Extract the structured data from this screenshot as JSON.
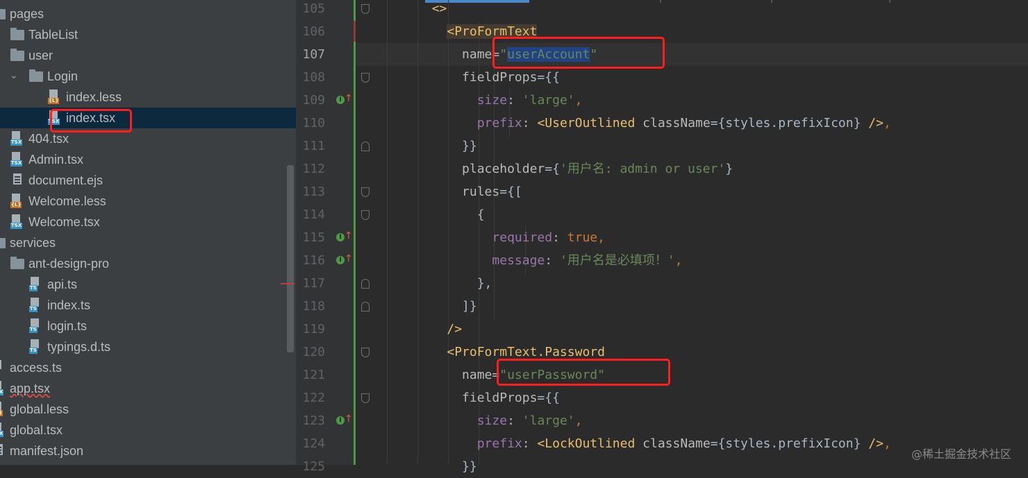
{
  "tree": {
    "items": [
      {
        "label": "pages",
        "indent": 0,
        "icon": "folder",
        "expanded": true
      },
      {
        "label": "TableList",
        "indent": 1,
        "icon": "folder"
      },
      {
        "label": "user",
        "indent": 1,
        "icon": "folder"
      },
      {
        "label": "Login",
        "indent": 2,
        "icon": "folder",
        "expanded": true
      },
      {
        "label": "index.less",
        "indent": 3,
        "icon": "less"
      },
      {
        "label": "index.tsx",
        "indent": 3,
        "icon": "tsx",
        "selected": true
      },
      {
        "label": "404.tsx",
        "indent": 1,
        "icon": "tsx"
      },
      {
        "label": "Admin.tsx",
        "indent": 1,
        "icon": "tsx"
      },
      {
        "label": "document.ejs",
        "indent": 1,
        "icon": "doc"
      },
      {
        "label": "Welcome.less",
        "indent": 1,
        "icon": "less"
      },
      {
        "label": "Welcome.tsx",
        "indent": 1,
        "icon": "tsx"
      },
      {
        "label": "services",
        "indent": 0,
        "icon": "folder",
        "expanded": true
      },
      {
        "label": "ant-design-pro",
        "indent": 1,
        "icon": "folder"
      },
      {
        "label": "api.ts",
        "indent": 2,
        "icon": "ts"
      },
      {
        "label": "index.ts",
        "indent": 2,
        "icon": "ts"
      },
      {
        "label": "login.ts",
        "indent": 2,
        "icon": "ts"
      },
      {
        "label": "typings.d.ts",
        "indent": 2,
        "icon": "ts"
      },
      {
        "label": "access.ts",
        "indent": 0,
        "icon": "ts"
      },
      {
        "label": "app.tsx",
        "indent": 0,
        "icon": "tsx",
        "error": true
      },
      {
        "label": "global.less",
        "indent": 0,
        "icon": "less"
      },
      {
        "label": "global.tsx",
        "indent": 0,
        "icon": "tsx"
      },
      {
        "label": "manifest.json",
        "indent": 0,
        "icon": "json"
      }
    ],
    "icon_tags": {
      "tsx": "TSX",
      "ts": "TS",
      "less": "{L}"
    }
  },
  "editor": {
    "current_line": "107",
    "lines": [
      {
        "num": "105",
        "fold": "open",
        "tokens": [
          {
            "t": "        "
          },
          {
            "t": "<>",
            "c": "tg"
          }
        ]
      },
      {
        "num": "106",
        "tokens": [
          {
            "t": "          "
          },
          {
            "t": "<ProFormText",
            "c": "tg",
            "bg": "tagbg"
          }
        ]
      },
      {
        "num": "107",
        "tokens": [
          {
            "t": "            "
          },
          {
            "t": "name",
            "c": "at"
          },
          {
            "t": "=",
            "c": "cl"
          },
          {
            "t": "\"",
            "c": "st"
          },
          {
            "t": "userAccount",
            "c": "st",
            "bg": "selbg"
          },
          {
            "t": "\"",
            "c": "st"
          }
        ]
      },
      {
        "num": "108",
        "fold": "open",
        "tokens": [
          {
            "t": "            "
          },
          {
            "t": "fieldProps",
            "c": "at"
          },
          {
            "t": "={{",
            "c": "cl"
          }
        ]
      },
      {
        "num": "109",
        "marker": true,
        "tokens": [
          {
            "t": "              "
          },
          {
            "t": "size",
            "c": "pp"
          },
          {
            "t": ": ",
            "c": "cl"
          },
          {
            "t": "'large'",
            "c": "st"
          },
          {
            "t": ",",
            "c": "kw"
          }
        ]
      },
      {
        "num": "110",
        "tokens": [
          {
            "t": "              "
          },
          {
            "t": "prefix",
            "c": "pp"
          },
          {
            "t": ": ",
            "c": "cl"
          },
          {
            "t": "<UserOutlined",
            "c": "tg"
          },
          {
            "t": " className",
            "c": "at"
          },
          {
            "t": "={styles.prefixIcon} ",
            "c": "cl"
          },
          {
            "t": "/>",
            "c": "tg"
          },
          {
            "t": ",",
            "c": "kw"
          }
        ]
      },
      {
        "num": "111",
        "fold": "close",
        "tokens": [
          {
            "t": "            "
          },
          {
            "t": "}}",
            "c": "cl"
          }
        ]
      },
      {
        "num": "112",
        "tokens": [
          {
            "t": "            "
          },
          {
            "t": "placeholder",
            "c": "at"
          },
          {
            "t": "={",
            "c": "cl"
          },
          {
            "t": "'用户名: admin or user'",
            "c": "st"
          },
          {
            "t": "}",
            "c": "cl"
          }
        ]
      },
      {
        "num": "113",
        "fold": "open",
        "tokens": [
          {
            "t": "            "
          },
          {
            "t": "rules",
            "c": "at"
          },
          {
            "t": "={[",
            "c": "cl"
          }
        ]
      },
      {
        "num": "114",
        "fold": "open",
        "tokens": [
          {
            "t": "              "
          },
          {
            "t": "{",
            "c": "cl"
          }
        ]
      },
      {
        "num": "115",
        "marker": true,
        "tokens": [
          {
            "t": "                "
          },
          {
            "t": "required",
            "c": "pp"
          },
          {
            "t": ": ",
            "c": "cl"
          },
          {
            "t": "true",
            "c": "kw"
          },
          {
            "t": ",",
            "c": "kw"
          }
        ]
      },
      {
        "num": "116",
        "marker": true,
        "tokens": [
          {
            "t": "                "
          },
          {
            "t": "message",
            "c": "pp"
          },
          {
            "t": ": ",
            "c": "cl"
          },
          {
            "t": "'用户名是必填项！'",
            "c": "st"
          },
          {
            "t": ",",
            "c": "kw"
          }
        ]
      },
      {
        "num": "117",
        "fold": "close",
        "tokens": [
          {
            "t": "              "
          },
          {
            "t": "},",
            "c": "cl"
          }
        ]
      },
      {
        "num": "118",
        "fold": "close",
        "tokens": [
          {
            "t": "            "
          },
          {
            "t": "]}",
            "c": "cl"
          }
        ]
      },
      {
        "num": "119",
        "tokens": [
          {
            "t": "          "
          },
          {
            "t": "/>",
            "c": "tg"
          }
        ]
      },
      {
        "num": "120",
        "fold": "open",
        "tokens": [
          {
            "t": "          "
          },
          {
            "t": "<ProFormText.Password",
            "c": "tg"
          }
        ]
      },
      {
        "num": "121",
        "tokens": [
          {
            "t": "            "
          },
          {
            "t": "name",
            "c": "at"
          },
          {
            "t": "=",
            "c": "cl"
          },
          {
            "t": "\"userPassword\"",
            "c": "st"
          }
        ]
      },
      {
        "num": "122",
        "fold": "open",
        "tokens": [
          {
            "t": "            "
          },
          {
            "t": "fieldProps",
            "c": "at"
          },
          {
            "t": "={{",
            "c": "cl"
          }
        ]
      },
      {
        "num": "123",
        "marker": true,
        "tokens": [
          {
            "t": "              "
          },
          {
            "t": "size",
            "c": "pp"
          },
          {
            "t": ": ",
            "c": "cl"
          },
          {
            "t": "'large'",
            "c": "st"
          },
          {
            "t": ",",
            "c": "kw"
          }
        ]
      },
      {
        "num": "124",
        "tokens": [
          {
            "t": "              "
          },
          {
            "t": "prefix",
            "c": "pp"
          },
          {
            "t": ": ",
            "c": "cl"
          },
          {
            "t": "<LockOutlined",
            "c": "tg"
          },
          {
            "t": " className",
            "c": "at"
          },
          {
            "t": "={styles.prefixIcon} ",
            "c": "cl"
          },
          {
            "t": "/>",
            "c": "tg"
          },
          {
            "t": ",",
            "c": "kw"
          }
        ]
      },
      {
        "num": "125",
        "tokens": [
          {
            "t": "            "
          },
          {
            "t": "}}",
            "c": "cl"
          }
        ]
      }
    ]
  },
  "watermark": "@稀土掘金技术社区",
  "colors": {
    "highlight_box": "#ff1d1d",
    "selection": "#214283",
    "tag": "#e8bf6a",
    "string": "#6a8759"
  }
}
